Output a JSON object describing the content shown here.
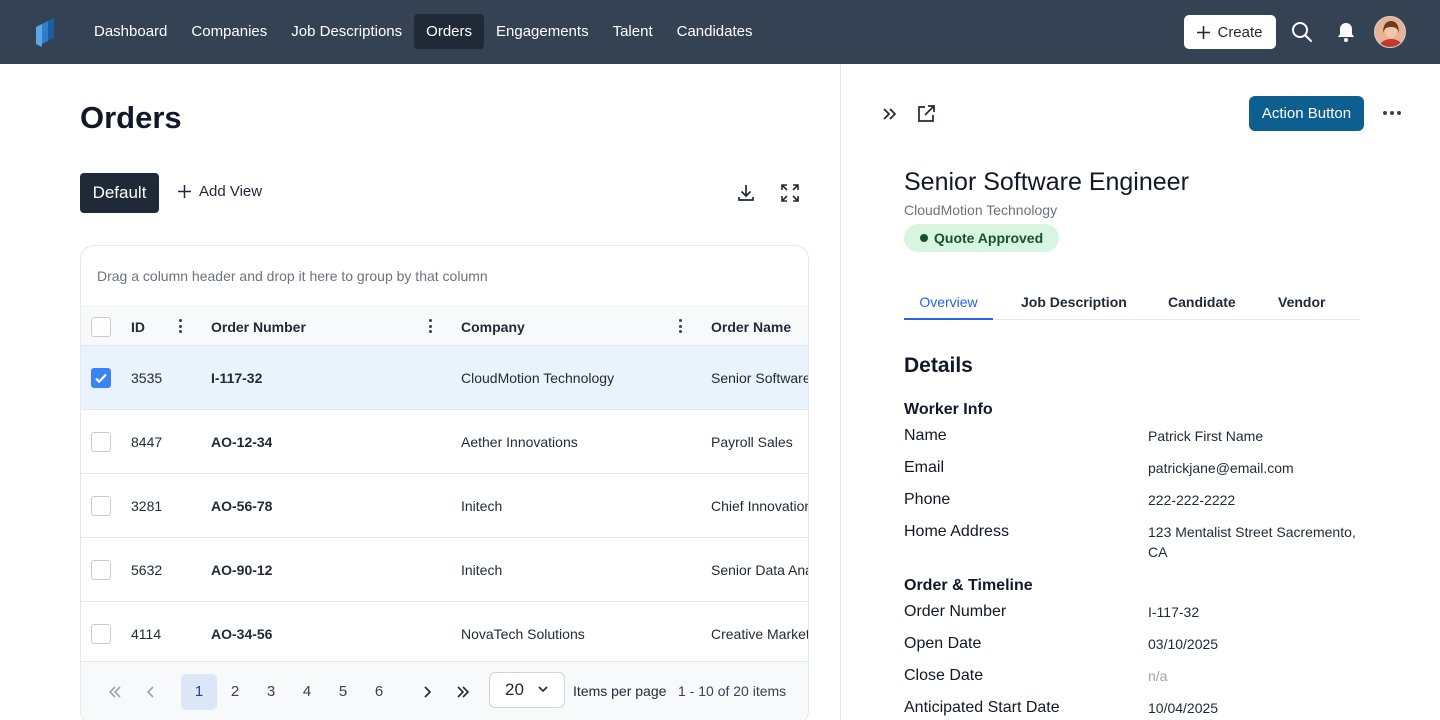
{
  "nav": {
    "items": [
      {
        "label": "Dashboard",
        "active": false
      },
      {
        "label": "Companies",
        "active": false
      },
      {
        "label": "Job Descriptions",
        "active": false
      },
      {
        "label": "Orders",
        "active": true
      },
      {
        "label": "Engagements",
        "active": false
      },
      {
        "label": "Talent",
        "active": false
      },
      {
        "label": "Candidates",
        "active": false
      }
    ],
    "create_label": "Create"
  },
  "page": {
    "title": "Orders",
    "default_view": "Default",
    "add_view": "Add View",
    "group_hint": "Drag a column header and drop it here to group by that column"
  },
  "table": {
    "columns": [
      "ID",
      "Order Number",
      "Company",
      "Order Name"
    ],
    "rows": [
      {
        "id": "3535",
        "order_number": "I-117-32",
        "company": "CloudMotion Technology",
        "order_name": "Senior Software Engineer",
        "selected": true
      },
      {
        "id": "8447",
        "order_number": "AO-12-34",
        "company": "Aether Innovations",
        "order_name": "Payroll Sales",
        "selected": false
      },
      {
        "id": "3281",
        "order_number": "AO-56-78",
        "company": "Initech",
        "order_name": "Chief Innovation Officer",
        "selected": false
      },
      {
        "id": "5632",
        "order_number": "AO-90-12",
        "company": "Initech",
        "order_name": "Senior Data Analyst",
        "selected": false
      },
      {
        "id": "4114",
        "order_number": "AO-34-56",
        "company": "NovaTech Solutions",
        "order_name": "Creative Marketing",
        "selected": false
      }
    ]
  },
  "pager": {
    "pages": [
      "1",
      "2",
      "3",
      "4",
      "5",
      "6"
    ],
    "current_page": "1",
    "page_size": "20",
    "items_per_page_label": "Items per page",
    "items_count": "1 - 10 of 20 items"
  },
  "detail": {
    "action_button": "Action Button",
    "title": "Senior Software Engineer",
    "company": "CloudMotion Technology",
    "status": "Quote Approved",
    "tabs": [
      "Overview",
      "Job Description",
      "Candidate",
      "Vendor"
    ],
    "active_tab": "Overview",
    "details_heading": "Details",
    "worker_info": {
      "heading": "Worker Info",
      "name_label": "Name",
      "name": "Patrick First Name",
      "email_label": "Email",
      "email": "patrickjane@email.com",
      "phone_label": "Phone",
      "phone": "222-222-2222",
      "address_label": "Home Address",
      "address": "123 Mentalist Street Sacremento, CA"
    },
    "order_timeline": {
      "heading": "Order & Timeline",
      "order_number_label": "Order Number",
      "order_number": "I-117-32",
      "open_date_label": "Open Date",
      "open_date": "03/10/2025",
      "close_date_label": "Close Date",
      "close_date": "n/a",
      "start_date_label": "Anticipated Start Date",
      "start_date": "10/04/2025"
    }
  },
  "colors": {
    "topbar": "#344254",
    "primary": "#0d5f8f",
    "accent": "#2563eb",
    "status_bg": "#d8f5e1",
    "status_text": "#14532d"
  }
}
